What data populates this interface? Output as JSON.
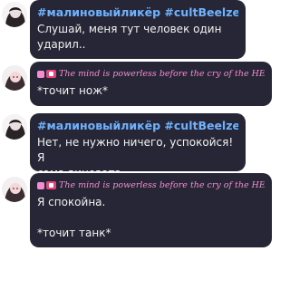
{
  "messages": [
    {
      "author": "#малиновыйликёр #cultBeelzeVia",
      "text": "Слушай, меня тут человек один\nударил.."
    },
    {
      "author": "The mind is powerless before the cry of the HEAR...",
      "text": "*точит нож*"
    },
    {
      "author": "#малиновыйликёр #cultBeelzeVia",
      "text": "Нет, не нужно ничего, успокойся! Я\nсама виновата.."
    },
    {
      "author": "The mind is powerless before the cry of the HEAR...",
      "text": "Я спокойна.\n\n*точит танк*"
    }
  ],
  "colors": {
    "bubble": "#262637",
    "author_blue": "#6fb3ff",
    "author_pink": "#f58bd0",
    "page": "#ffffff"
  }
}
